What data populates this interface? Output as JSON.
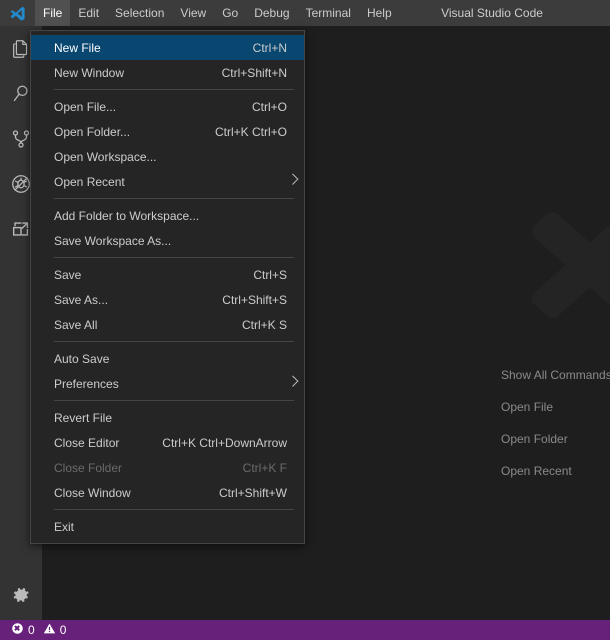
{
  "titlebar": {
    "logo_icon": "vscode-logo-icon",
    "window_title": "Visual Studio Code",
    "menus": [
      {
        "label": "File",
        "active": true
      },
      {
        "label": "Edit",
        "active": false
      },
      {
        "label": "Selection",
        "active": false
      },
      {
        "label": "View",
        "active": false
      },
      {
        "label": "Go",
        "active": false
      },
      {
        "label": "Debug",
        "active": false
      },
      {
        "label": "Terminal",
        "active": false
      },
      {
        "label": "Help",
        "active": false
      }
    ]
  },
  "activitybar": {
    "items": [
      {
        "name": "explorer-icon",
        "title": "Explorer"
      },
      {
        "name": "search-icon",
        "title": "Search"
      },
      {
        "name": "source-control-icon",
        "title": "Source Control"
      },
      {
        "name": "debug-icon",
        "title": "Debug"
      },
      {
        "name": "extensions-icon",
        "title": "Extensions"
      }
    ],
    "bottom": {
      "name": "gear-icon",
      "title": "Manage"
    }
  },
  "file_menu": {
    "items": [
      {
        "label": "New File",
        "key": "Ctrl+N",
        "selected": true,
        "disabled": false,
        "submenu": false
      },
      {
        "label": "New Window",
        "key": "Ctrl+Shift+N",
        "selected": false,
        "disabled": false,
        "submenu": false
      },
      {
        "separator": true
      },
      {
        "label": "Open File...",
        "key": "Ctrl+O",
        "selected": false,
        "disabled": false,
        "submenu": false
      },
      {
        "label": "Open Folder...",
        "key": "Ctrl+K Ctrl+O",
        "selected": false,
        "disabled": false,
        "submenu": false
      },
      {
        "label": "Open Workspace...",
        "key": "",
        "selected": false,
        "disabled": false,
        "submenu": false
      },
      {
        "label": "Open Recent",
        "key": "",
        "selected": false,
        "disabled": false,
        "submenu": true
      },
      {
        "separator": true
      },
      {
        "label": "Add Folder to Workspace...",
        "key": "",
        "selected": false,
        "disabled": false,
        "submenu": false
      },
      {
        "label": "Save Workspace As...",
        "key": "",
        "selected": false,
        "disabled": false,
        "submenu": false
      },
      {
        "separator": true
      },
      {
        "label": "Save",
        "key": "Ctrl+S",
        "selected": false,
        "disabled": false,
        "submenu": false
      },
      {
        "label": "Save As...",
        "key": "Ctrl+Shift+S",
        "selected": false,
        "disabled": false,
        "submenu": false
      },
      {
        "label": "Save All",
        "key": "Ctrl+K S",
        "selected": false,
        "disabled": false,
        "submenu": false
      },
      {
        "separator": true
      },
      {
        "label": "Auto Save",
        "key": "",
        "selected": false,
        "disabled": false,
        "submenu": false
      },
      {
        "label": "Preferences",
        "key": "",
        "selected": false,
        "disabled": false,
        "submenu": true
      },
      {
        "separator": true
      },
      {
        "label": "Revert File",
        "key": "",
        "selected": false,
        "disabled": false,
        "submenu": false
      },
      {
        "label": "Close Editor",
        "key": "Ctrl+K Ctrl+DownArrow",
        "selected": false,
        "disabled": false,
        "submenu": false
      },
      {
        "label": "Close Folder",
        "key": "Ctrl+K F",
        "selected": false,
        "disabled": true,
        "submenu": false
      },
      {
        "label": "Close Window",
        "key": "Ctrl+Shift+W",
        "selected": false,
        "disabled": false,
        "submenu": false
      },
      {
        "separator": true
      },
      {
        "label": "Exit",
        "key": "",
        "selected": false,
        "disabled": false,
        "submenu": false
      }
    ]
  },
  "editor": {
    "watermark_logo": "vscode-watermark-logo",
    "shortcuts": [
      {
        "label": "Show All Commands"
      },
      {
        "label": "Open File"
      },
      {
        "label": "Open Folder"
      },
      {
        "label": "Open Recent"
      }
    ]
  },
  "statusbar": {
    "background": "#68217a",
    "errors_icon": "error-circle-icon",
    "errors_count": "0",
    "warnings_icon": "warning-triangle-icon",
    "warnings_count": "0"
  }
}
